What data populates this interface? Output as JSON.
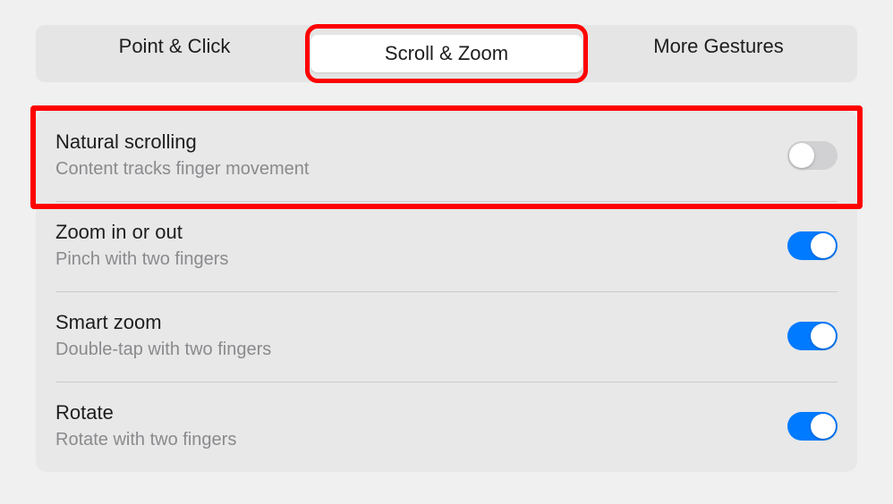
{
  "tabs": {
    "point_click": "Point & Click",
    "scroll_zoom": "Scroll & Zoom",
    "more_gestures": "More Gestures",
    "active": "scroll_zoom"
  },
  "settings": [
    {
      "id": "natural-scrolling",
      "title": "Natural scrolling",
      "subtitle": "Content tracks finger movement",
      "enabled": false
    },
    {
      "id": "zoom-in-out",
      "title": "Zoom in or out",
      "subtitle": "Pinch with two fingers",
      "enabled": true
    },
    {
      "id": "smart-zoom",
      "title": "Smart zoom",
      "subtitle": "Double-tap with two fingers",
      "enabled": true
    },
    {
      "id": "rotate",
      "title": "Rotate",
      "subtitle": "Rotate with two fingers",
      "enabled": true
    }
  ],
  "highlight": {
    "tab_index": 1,
    "row_index": 0
  },
  "colors": {
    "accent": "#007aff",
    "highlight": "#ff0000"
  }
}
